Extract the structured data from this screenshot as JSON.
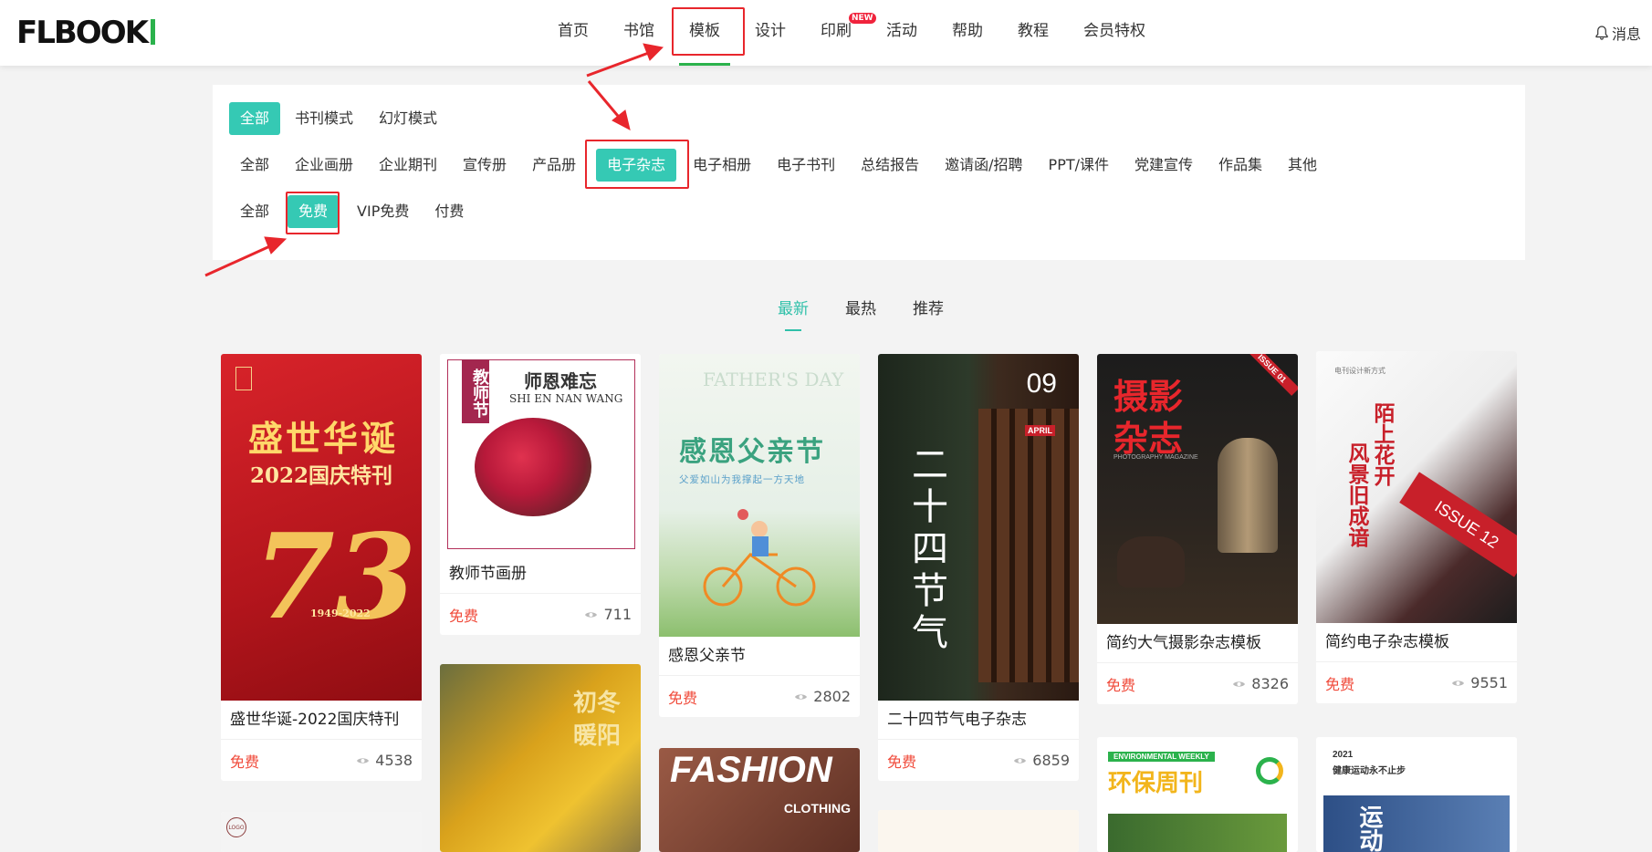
{
  "header": {
    "logo_text": "FLBOOK",
    "nav": [
      "首页",
      "书馆",
      "模板",
      "设计",
      "印刷",
      "活动",
      "帮助",
      "教程",
      "会员特权"
    ],
    "new_badge": "NEW",
    "messages_label": "消息"
  },
  "filters": {
    "mode": [
      "全部",
      "书刊模式",
      "幻灯模式"
    ],
    "category": [
      "全部",
      "企业画册",
      "企业期刊",
      "宣传册",
      "产品册",
      "电子杂志",
      "电子相册",
      "电子书刊",
      "总结报告",
      "邀请函/招聘",
      "PPT/课件",
      "党建宣传",
      "作品集",
      "其他"
    ],
    "price": [
      "全部",
      "免费",
      "VIP免费",
      "付费"
    ]
  },
  "sorts": [
    "最新",
    "最热",
    "推荐"
  ],
  "cards": [
    {
      "title": "盛世华诞-2022国庆特刊",
      "price": "免费",
      "views": "4538",
      "cover": {
        "t1": "盛世华诞",
        "t2": "2022国庆特刊",
        "t3": "73",
        "t4": "1949-2022"
      }
    },
    {
      "title": "教师节画册",
      "price": "免费",
      "views": "711",
      "cover": {
        "t1": "教师节",
        "t2": "师恩难忘",
        "t3": "SHI EN NAN WANG"
      }
    },
    {
      "title": "感恩父亲节",
      "price": "免费",
      "views": "2802",
      "cover": {
        "t1": "FATHER'S DAY",
        "t2": "感恩父亲节",
        "t3": "父爱如山为我撑起一方天地"
      }
    },
    {
      "title": "二十四节气电子杂志",
      "price": "免费",
      "views": "6859",
      "cover": {
        "t1": "二十四节气",
        "t2": "09",
        "t3": "APRIL"
      }
    },
    {
      "title": "简约大气摄影杂志模板",
      "price": "免费",
      "views": "8326",
      "cover": {
        "t1": "摄影",
        "t2": "杂志",
        "t3": "PHOTOGRAPHY MAGAZINE",
        "t4": "ISSUE 01"
      }
    },
    {
      "title": "简约电子杂志模板",
      "price": "免费",
      "views": "9551",
      "cover": {
        "t1": "陌上花开",
        "t2": "风景旧成谙",
        "t3": "ISSUE 12",
        "t4": "电刊设计新方式"
      }
    }
  ],
  "partial_covers": [
    {
      "t1": "初冬",
      "t2": "暖阳"
    },
    {
      "t1": "FASHION",
      "t2": "CLOTHING"
    },
    {
      "t1": "环保周刊",
      "t2": "ENVIRONMENTAL WEEKLY"
    },
    {
      "t1": "2021",
      "t2": "健康运动永不止步",
      "t3": "运动"
    },
    {
      "t1": "LOGO"
    }
  ],
  "colors": {
    "accent": "#2bb24c",
    "chip": "#35c9b4",
    "price": "#f04a3a",
    "annotation": "#e8262c"
  }
}
